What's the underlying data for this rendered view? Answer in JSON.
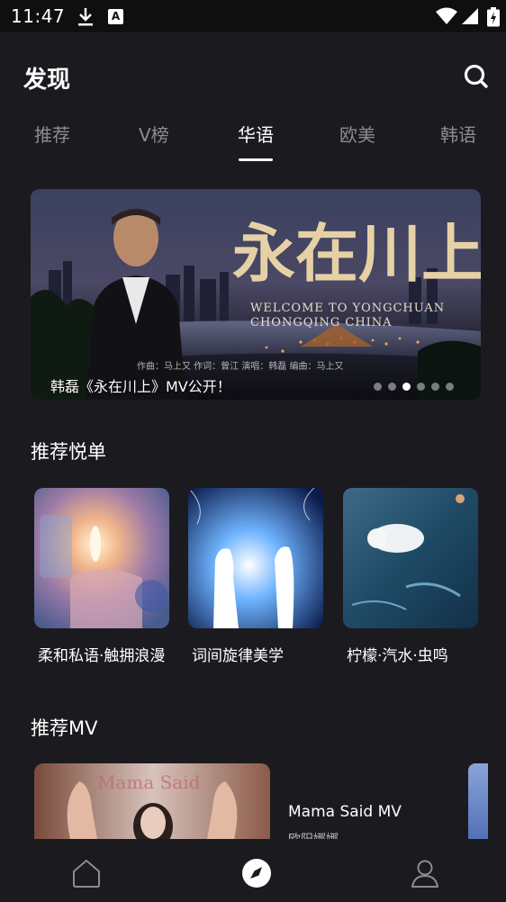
{
  "status_bar": {
    "time": "11:47",
    "a_badge": "A"
  },
  "header": {
    "title": "发现",
    "search_icon": "search-icon"
  },
  "tabs": [
    {
      "label": "推荐",
      "active": false
    },
    {
      "label": "V榜",
      "active": false
    },
    {
      "label": "华语",
      "active": true
    },
    {
      "label": "欧美",
      "active": false
    },
    {
      "label": "韩语",
      "active": false
    }
  ],
  "banner": {
    "caption": "韩磊《永在川上》MV公开！",
    "calligraphy": "永在川上",
    "subtitle_line1": "WELCOME TO YONGCHUAN",
    "subtitle_line2": "CHONGQING CHINA",
    "credits": "作曲：马上又   作词：曾江   演唱：韩磊   编曲：马上又",
    "dot_count": 6,
    "active_dot": 2
  },
  "sections": {
    "playlists_title": "推荐悦单",
    "mv_title": "推荐MV"
  },
  "playlists": [
    {
      "title": "柔和私语·触拥浪漫"
    },
    {
      "title": "词间旋律美学"
    },
    {
      "title": "柠檬·汽水·虫鸣"
    }
  ],
  "mv": {
    "title": "Mama Said  MV",
    "artist": "欧阳娜娜",
    "thumb_text": "Mama Said"
  },
  "colors": {
    "background": "#1b1b1f",
    "tab_inactive": "#8b8b90",
    "text": "#ffffff"
  },
  "bottom_nav": {
    "items": [
      "home-icon",
      "compass-icon",
      "user-icon"
    ],
    "active": "compass-icon"
  }
}
